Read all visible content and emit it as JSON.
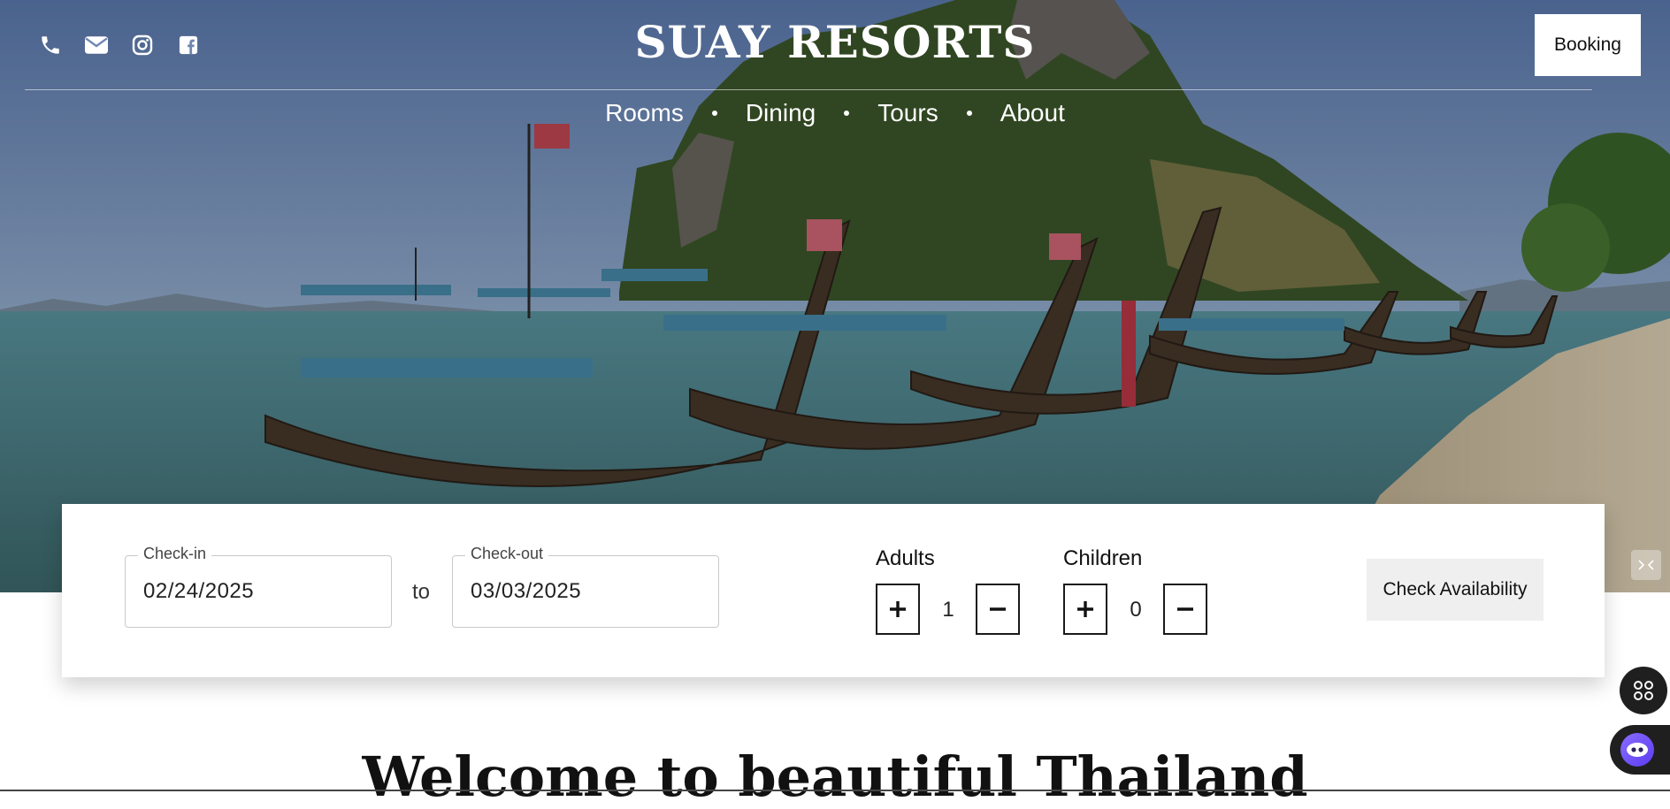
{
  "brand": {
    "name": "SUAY RESORTS"
  },
  "header": {
    "social_icons": [
      "phone-icon",
      "mail-icon",
      "instagram-icon",
      "facebook-icon"
    ],
    "booking_label": "Booking"
  },
  "nav": {
    "items": [
      {
        "label": "Rooms"
      },
      {
        "label": "Dining"
      },
      {
        "label": "Tours"
      },
      {
        "label": "About"
      }
    ]
  },
  "booking": {
    "checkin": {
      "label": "Check-in",
      "value": "02/24/2025"
    },
    "separator": "to",
    "checkout": {
      "label": "Check-out",
      "value": "03/03/2025"
    },
    "adults": {
      "label": "Adults",
      "value": "1"
    },
    "children": {
      "label": "Children",
      "value": "0"
    },
    "check_label": "Check Availability"
  },
  "welcome": {
    "title": "Welcome to beautiful Thailand"
  },
  "colors": {
    "overlay": "#000000",
    "card": "#ffffff",
    "check_button": "#efefef",
    "fab": "#1f1f1f",
    "assistant_accent": "#6c4cf6"
  }
}
